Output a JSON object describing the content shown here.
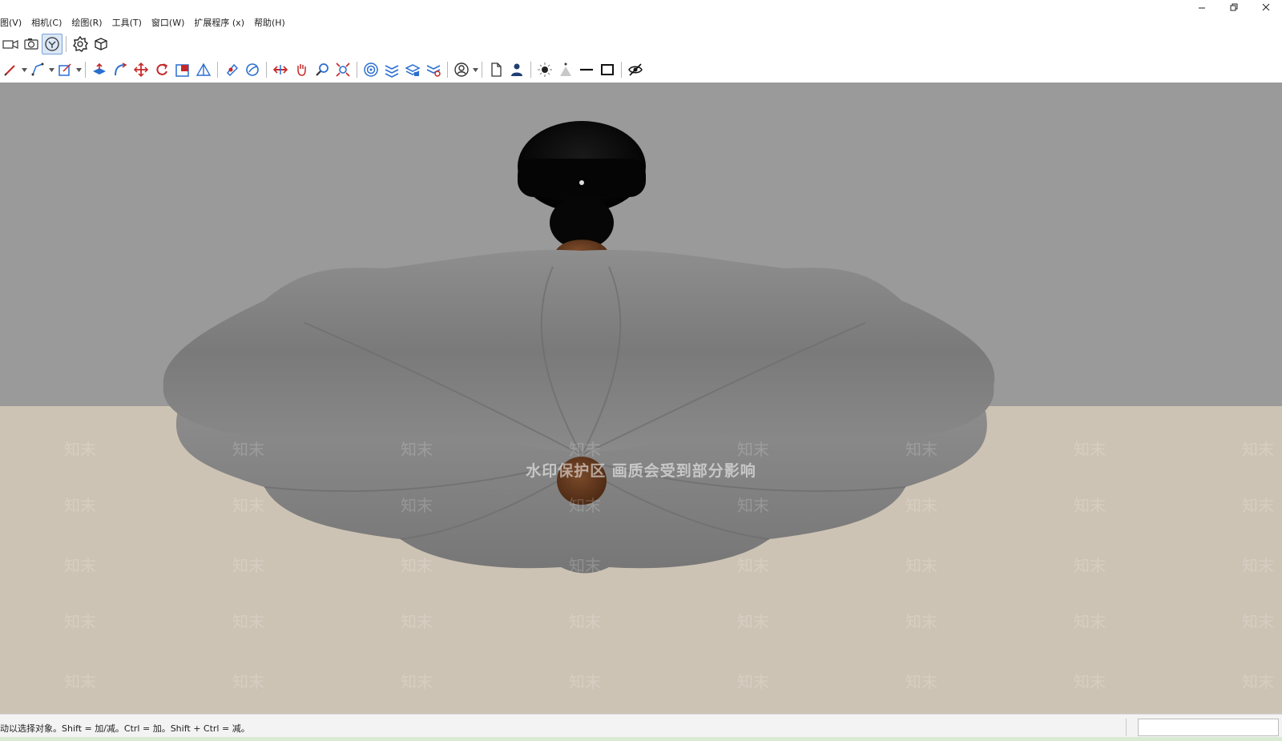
{
  "menu": {
    "items": [
      {
        "label": "图(V)"
      },
      {
        "label": "相机(C)"
      },
      {
        "label": "绘图(R)"
      },
      {
        "label": "工具(T)"
      },
      {
        "label": "窗口(W)"
      },
      {
        "label": "扩展程序 (x)"
      },
      {
        "label": "帮助(H)"
      }
    ]
  },
  "window_controls": {
    "minimize": "–",
    "restore": "❐",
    "close": "✕"
  },
  "toolbar_row1": [
    "camera-icon",
    "photo-camera-icon",
    "walk-icon",
    "gear-settings-icon",
    "box-view-icon"
  ],
  "toolbar_row2": [
    "pencil-icon",
    "pen-line-icon",
    "rectangle-draw-icon",
    "push-pull-icon",
    "follow-me-icon",
    "move-icon",
    "rotate-icon",
    "scale-icon",
    "triangle-icon",
    "paint-icon",
    "orbit-icon",
    "section-icon",
    "pan-icon",
    "zoom-icon",
    "zoom-extents-icon",
    "target-icon",
    "layers-icon",
    "layers-stack-icon",
    "layers-settings-icon",
    "user-circle-icon",
    "page-icon",
    "person-icon",
    "sun-icon",
    "shadow-icon",
    "line-icon",
    "square-icon",
    "hide-icon"
  ],
  "viewport": {
    "watermark_banner": "水印保护区  画质会受到部分影响",
    "watermark_tile": "知末",
    "colors": {
      "wall": "#9a9a9a",
      "floor": "#cdc3b4",
      "shade": "#808080",
      "wood": "#6b3a1e",
      "canopy": "#0a0a0a"
    }
  },
  "status": {
    "hint": "动以选择对象。Shift = 加/减。Ctrl = 加。Shift + Ctrl = 减。",
    "measurement_value": ""
  },
  "accent": "#2a6fd1"
}
